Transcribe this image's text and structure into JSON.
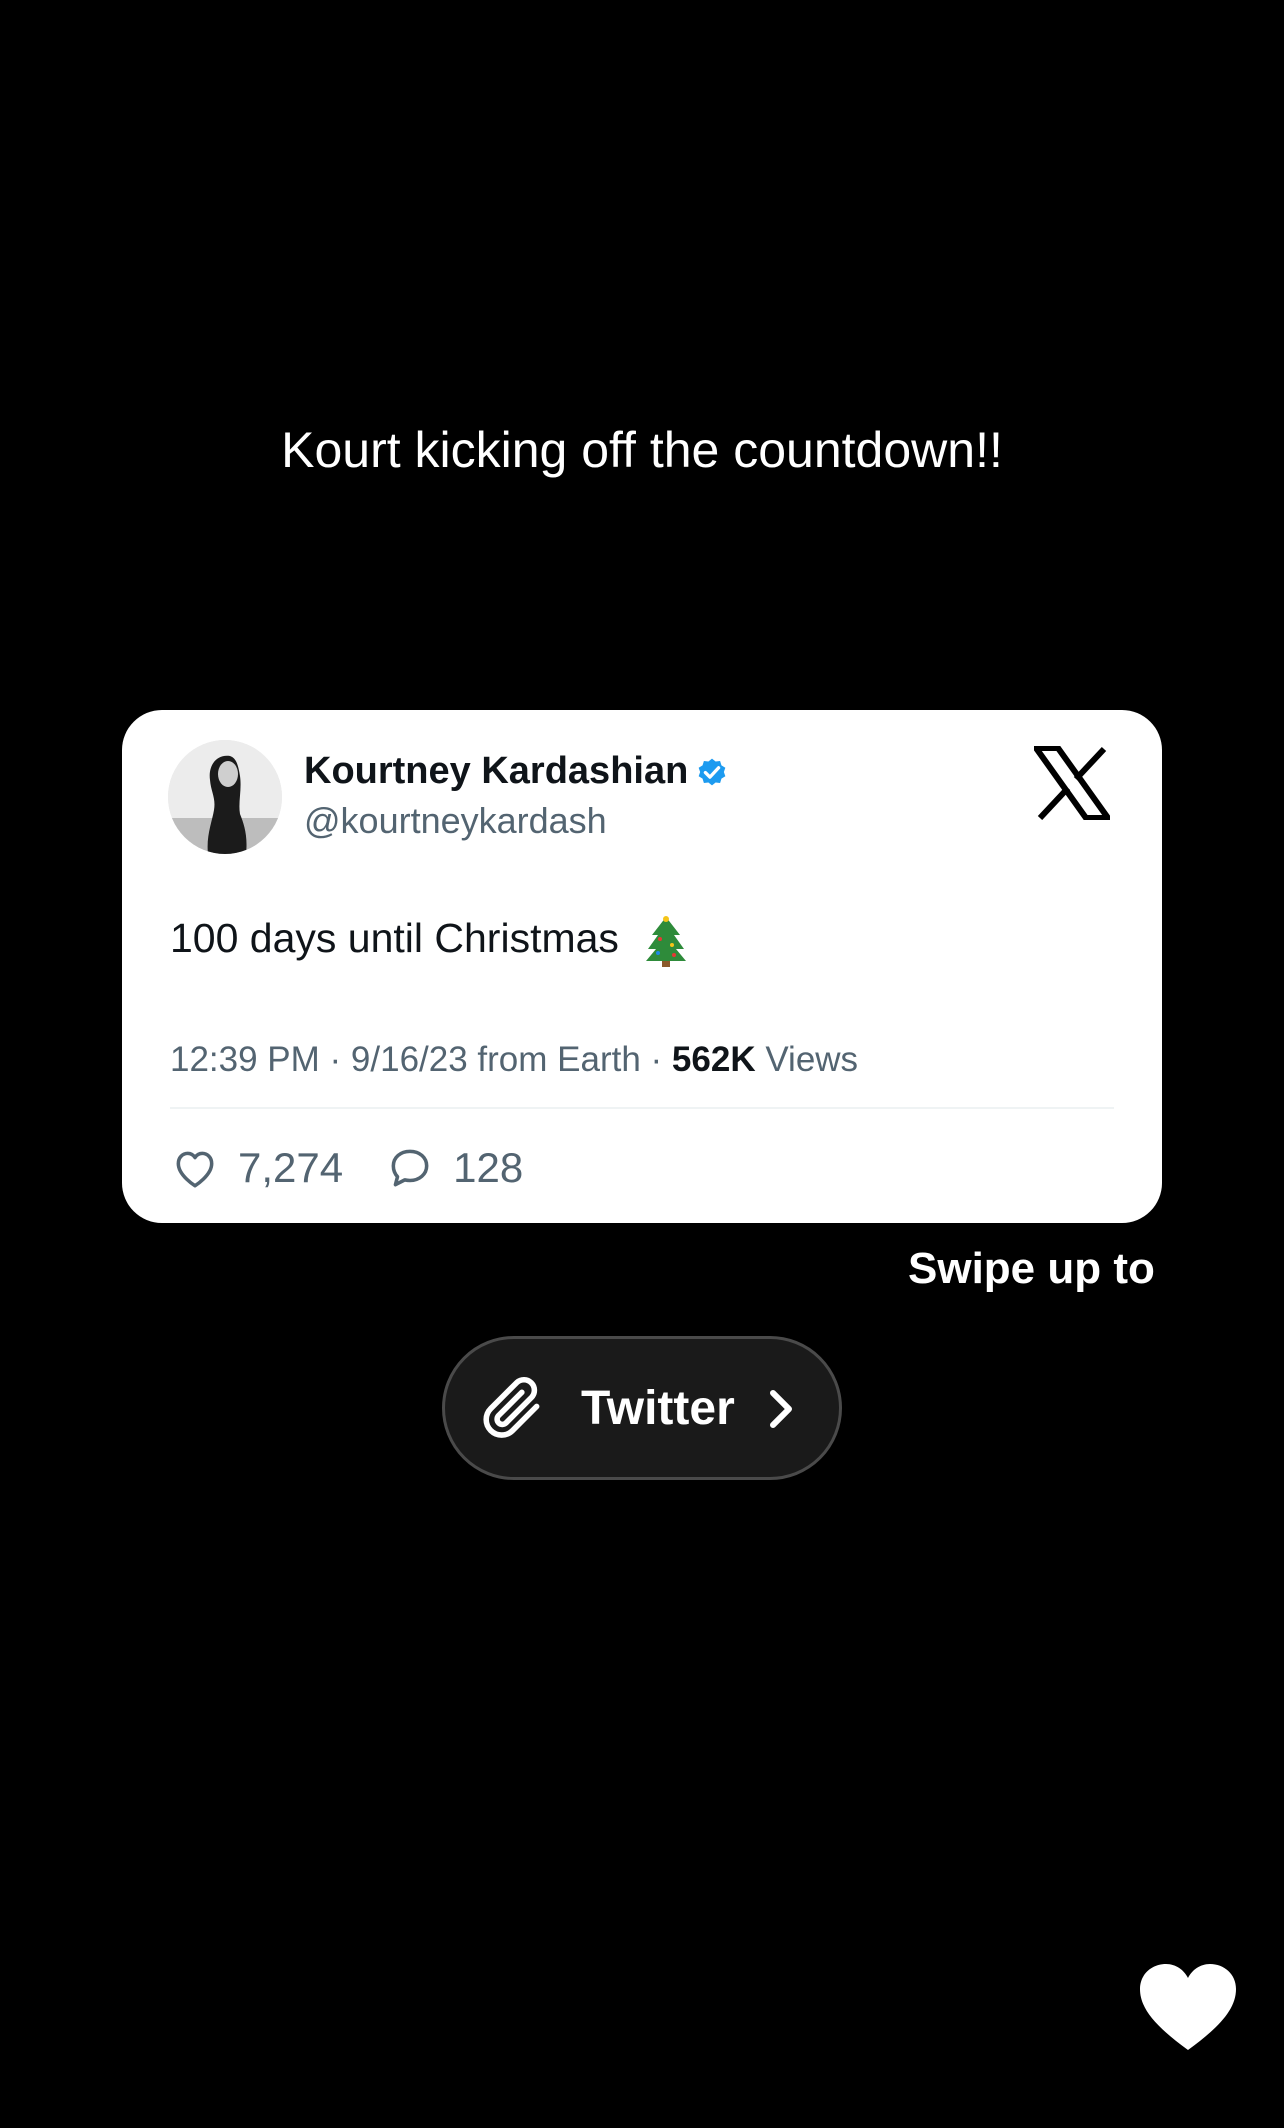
{
  "story": {
    "caption": "Kourt kicking off the countdown!!",
    "swipe_text": "Swipe up to",
    "link_sticker": {
      "label": "Twitter",
      "icon": "paperclip-icon",
      "chevron": "chevron-right-icon"
    },
    "like_icon": "heart-icon"
  },
  "tweet": {
    "display_name": "Kourtney Kardashian",
    "handle": "@kourtneykardash",
    "verified": true,
    "text": "100 days until Christmas",
    "emoji": "christmas-tree-icon",
    "time": "12:39 PM",
    "separator": " · ",
    "date_source": "9/16/23 from Earth",
    "views_count": "562K",
    "views_label": "Views",
    "likes": "7,274",
    "replies": "128",
    "platform_icon": "x-logo-icon"
  },
  "colors": {
    "background": "#000000",
    "card": "#ffffff",
    "verified_blue": "#1d9bf0",
    "secondary_text": "#536471",
    "primary_text": "#0f1419"
  }
}
